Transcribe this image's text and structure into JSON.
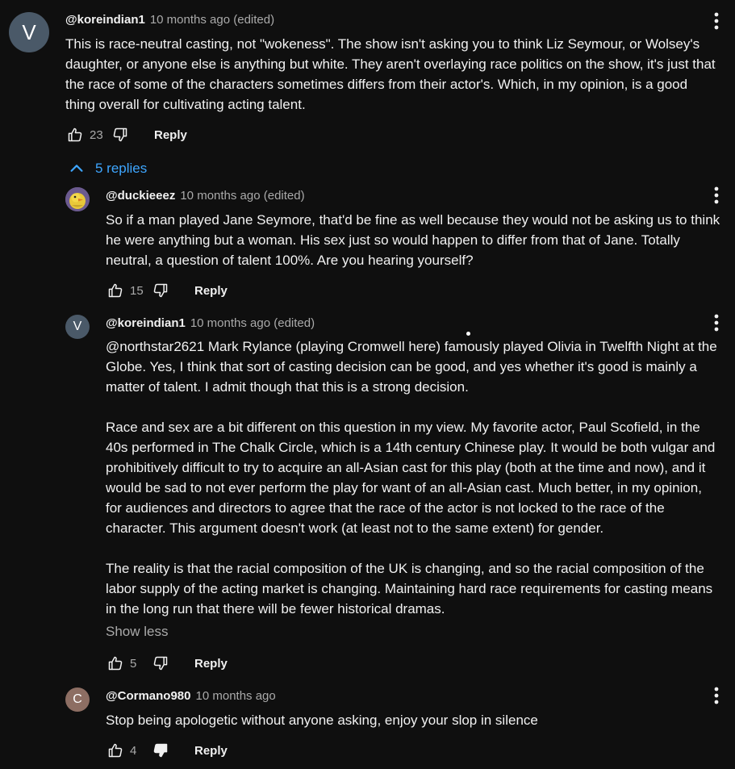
{
  "colors": {
    "background": "#0f0f0f",
    "text": "#f1f1f1",
    "meta": "#aaaaaa",
    "link": "#3ea6ff"
  },
  "comment": {
    "avatar_letter": "V",
    "avatar_color": "#4a5968",
    "author": "@koreindian1",
    "meta": "10 months ago (edited)",
    "text": "This is race-neutral casting, not \"wokeness\". The show isn't asking you to think Liz Seymour, or Wolsey's\ndaughter, or anyone else is anything but white. They aren't overlaying race politics on the show, it's just that\nthe race of some of the characters sometimes differs from their actor's. Which, in my opinion, is a good\nthing overall for cultivating acting talent.",
    "likes": "23",
    "reply_label": "Reply",
    "like_icon": "thumb-up-icon",
    "dislike_icon": "thumb-down-icon",
    "menu_icon": "more-vert-icon"
  },
  "replies_toggle": {
    "label": "5 replies",
    "icon": "chevron-up-icon"
  },
  "replies": [
    {
      "avatar_letter": "",
      "avatar_kind": "duck-image",
      "author": "@duckieeez",
      "meta": "10 months ago (edited)",
      "text": "So if a man played Jane Seymore, that'd be fine as well because they would not be asking us to think\nhe were anything but a woman. His sex just so would happen to differ from that of Jane. Totally\nneutral, a question of talent 100%. Are you hearing yourself?",
      "likes": "15",
      "reply_label": "Reply"
    },
    {
      "avatar_letter": "V",
      "avatar_color": "#4a5968",
      "author": "@koreindian1",
      "meta": "10 months ago (edited)",
      "text": "@northstar2621 Mark Rylance (playing Cromwell here) famously played Olivia in Twelfth Night at the\nGlobe. Yes, I think that sort of casting decision can be good, and yes whether it's good is mainly a\nmatter of talent. I admit though that this is a strong decision.\n\nRace and sex are a bit different on this question in my view. My favorite actor, Paul Scofield, in the\n40s performed in The Chalk Circle, which is a 14th century Chinese play. It would be both vulgar and\nprohibitively difficult to try to acquire an all-Asian cast for this play (both at the time and now), and it\nwould be sad to not ever perform the play for want of an all-Asian cast. Much better, in my opinion,\nfor audiences and directors to agree that the race of the actor is not locked to the race of the\ncharacter. This argument doesn't work (at least not to the same extent) for gender.\n\nThe reality is that the racial composition of the UK is changing, and so the racial composition of the\nlabor supply of the acting market is changing. Maintaining hard race requirements for casting means\nin the long run that there will be fewer historical dramas.",
      "show_less_label": "Show less",
      "likes": "5",
      "reply_label": "Reply"
    },
    {
      "avatar_letter": "C",
      "avatar_color": "#8d6e63",
      "author": "@Cormano980",
      "meta": "10 months ago",
      "text": "Stop being apologetic without anyone asking, enjoy your slop in silence",
      "likes": "4",
      "dislike_active": true,
      "reply_label": "Reply"
    }
  ]
}
